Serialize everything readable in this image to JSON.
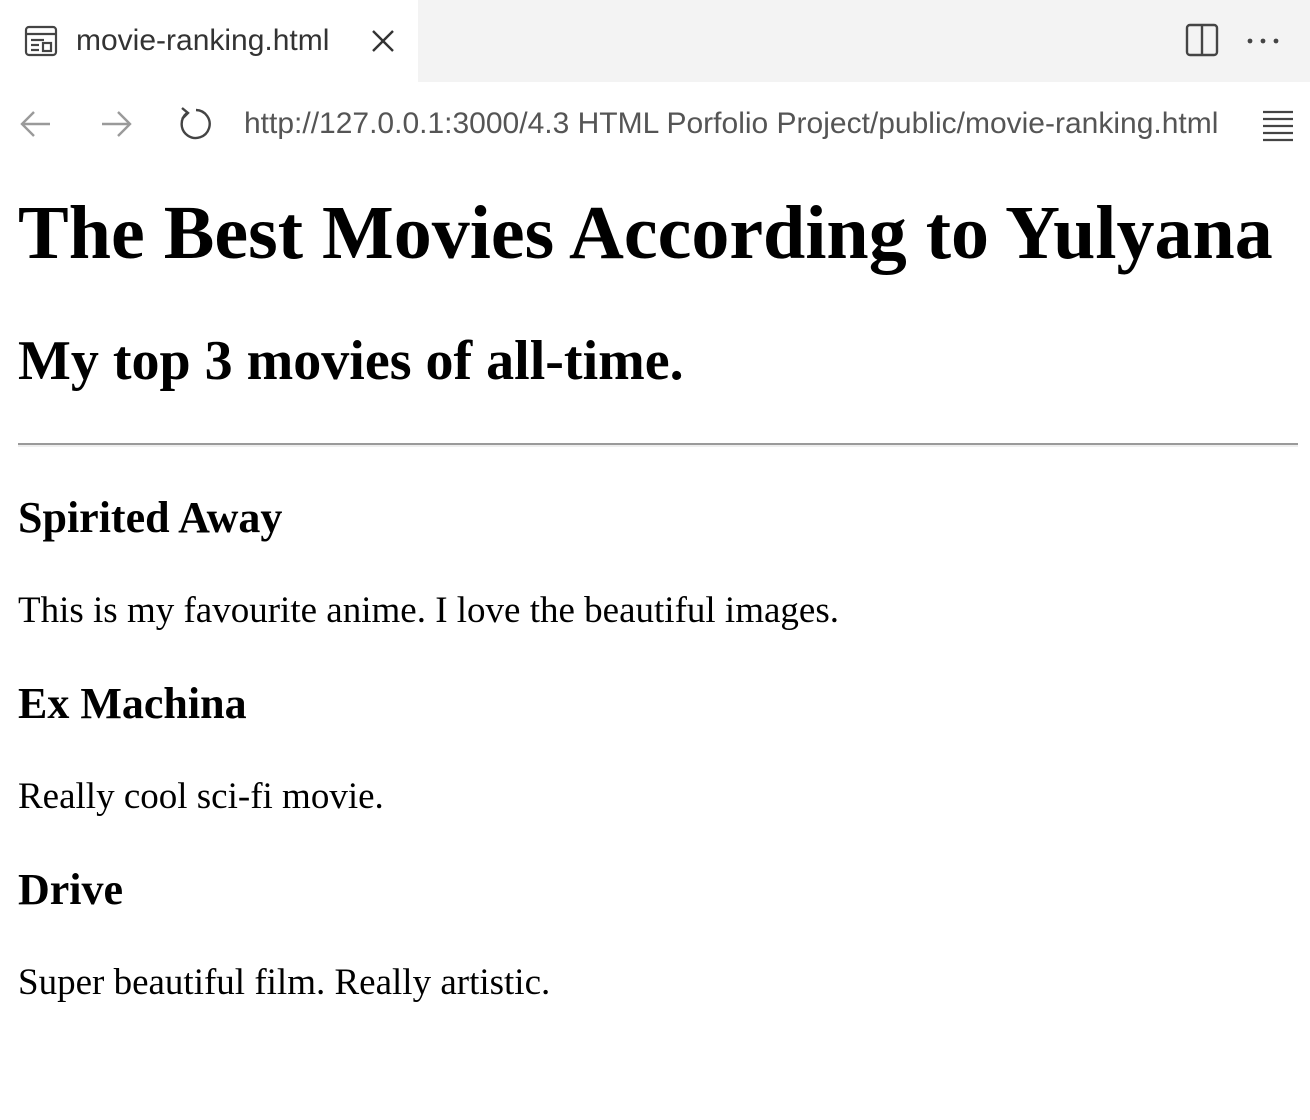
{
  "tab": {
    "title": "movie-ranking.html",
    "icon": "page-preview-icon"
  },
  "toolbar": {
    "icons": [
      "split-editor-icon",
      "more-actions-icon"
    ]
  },
  "navigation": {
    "url": "http://127.0.0.1:3000/4.3 HTML Porfolio Project/public/movie-ranking.html",
    "icons": [
      "back-arrow-icon",
      "forward-arrow-icon",
      "reload-icon",
      "menu-icon"
    ]
  },
  "page": {
    "heading": "The Best Movies According to Yulyana",
    "subheading": "My top 3 movies of all-time.",
    "movies": [
      {
        "title": "Spirited Away",
        "description": "This is my favourite anime. I love the beautiful images."
      },
      {
        "title": "Ex Machina",
        "description": "Really cool sci-fi movie."
      },
      {
        "title": "Drive",
        "description": "Super beautiful film. Really artistic."
      }
    ]
  }
}
